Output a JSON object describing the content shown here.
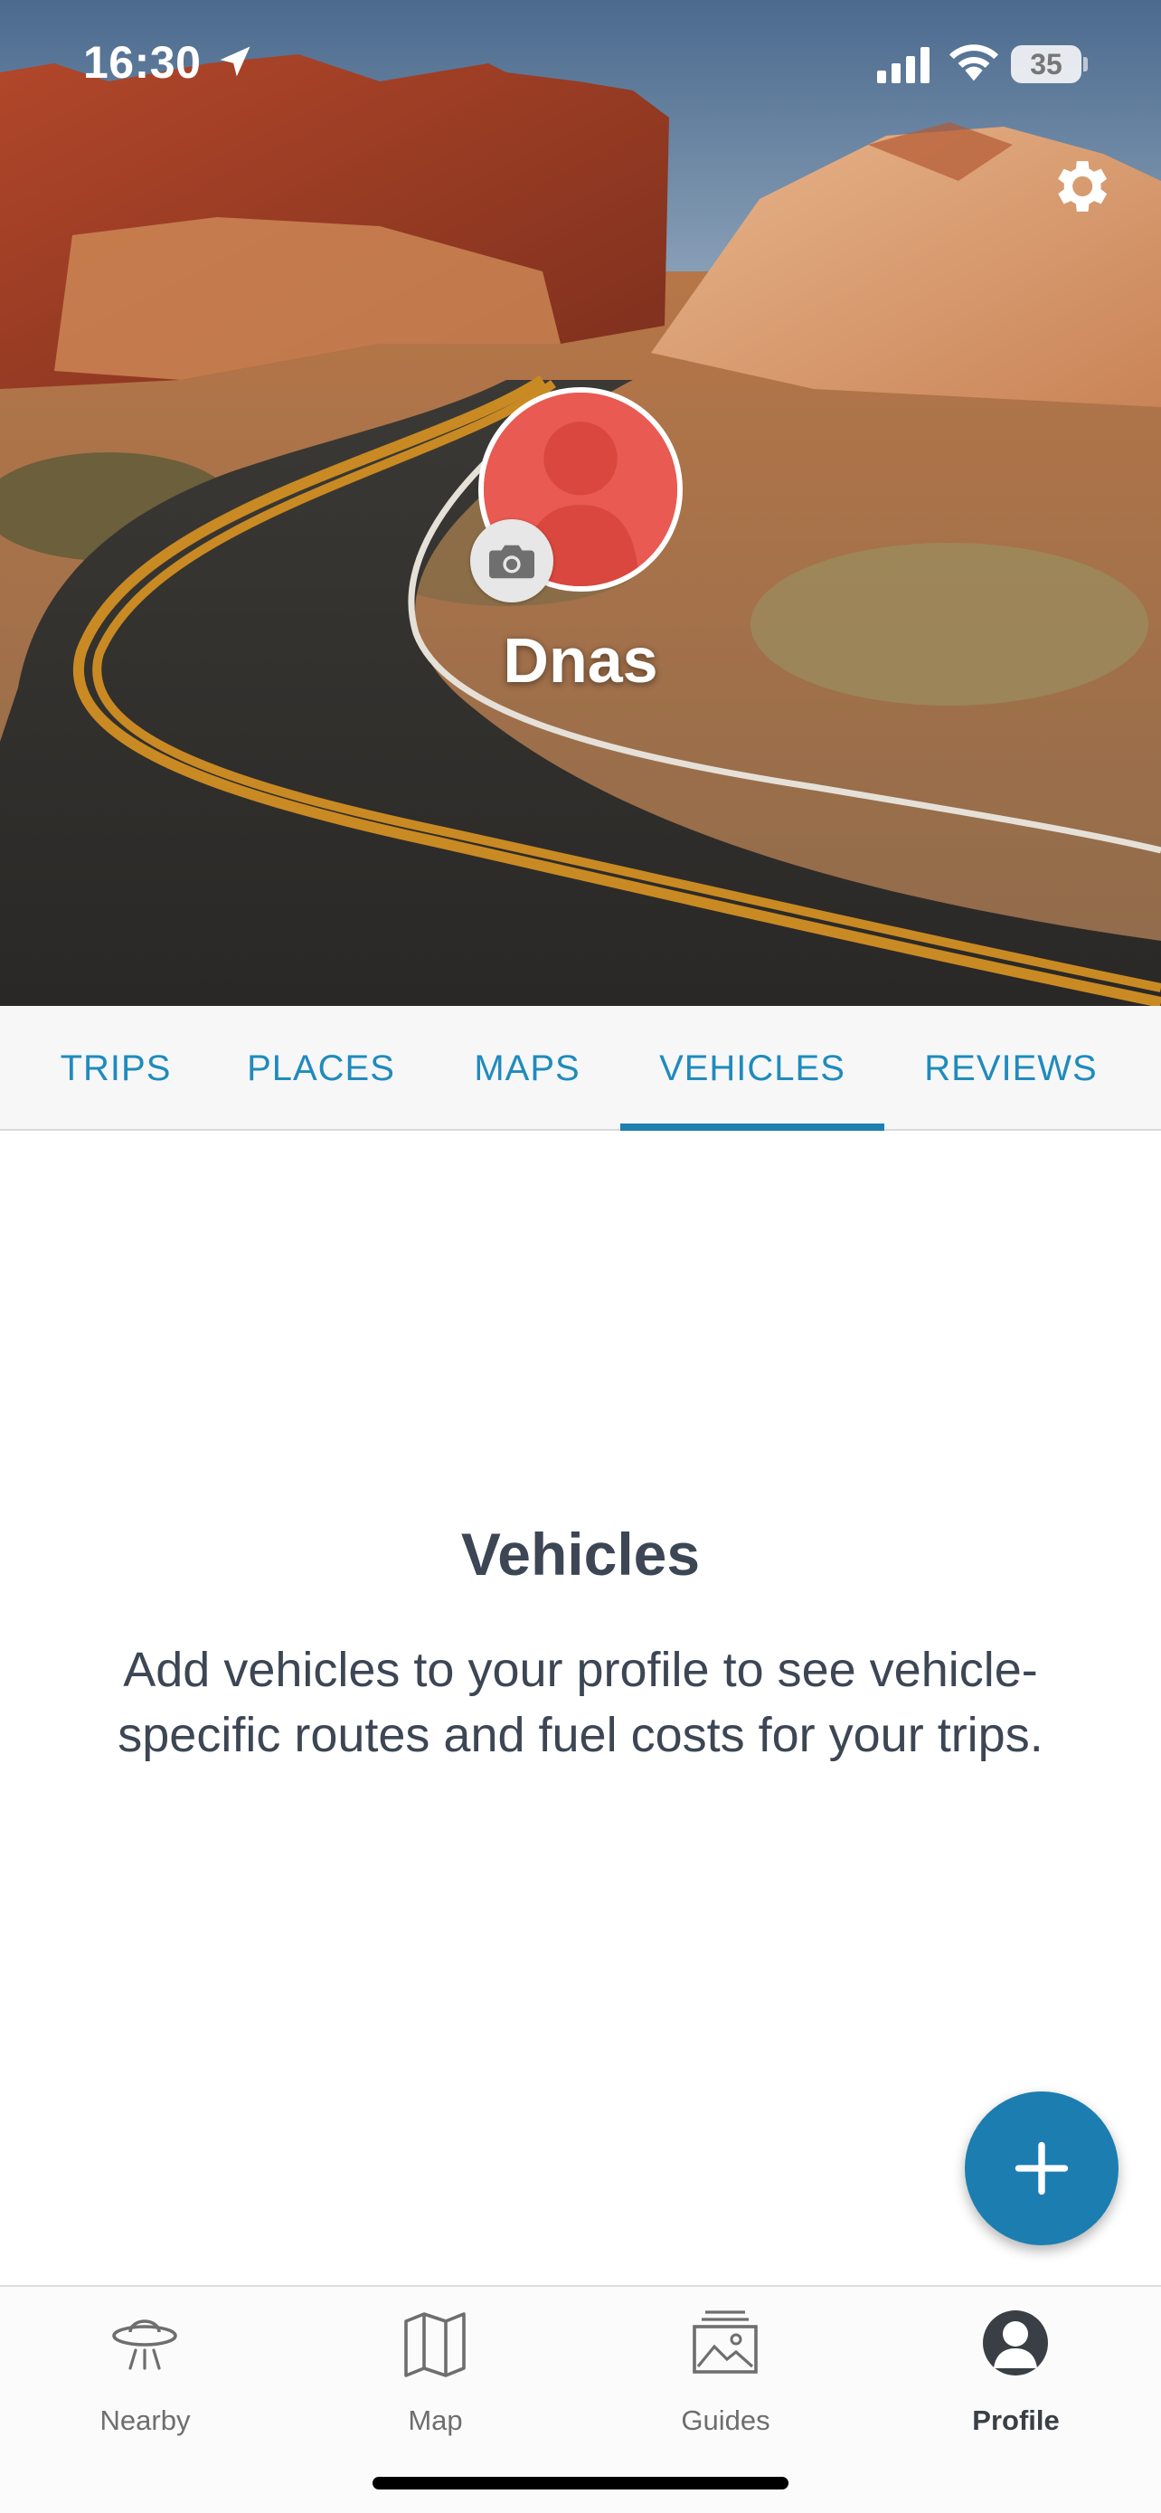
{
  "status_bar": {
    "time": "16:30",
    "battery": "35"
  },
  "profile": {
    "name": "Dnas",
    "avatar_color": "#e95a52"
  },
  "tabs": [
    {
      "label": "TRIPS",
      "active": false
    },
    {
      "label": "PLACES",
      "active": false
    },
    {
      "label": "MAPS",
      "active": false
    },
    {
      "label": "VEHICLES",
      "active": true
    },
    {
      "label": "REVIEWS",
      "active": false
    }
  ],
  "empty_state": {
    "title": "Vehicles",
    "text": "Add vehicles to your profile to see vehicle-specific routes and fuel costs for your trips."
  },
  "fab": {
    "icon": "plus-icon",
    "color": "#1c7eb0"
  },
  "bottom_nav": [
    {
      "label": "Nearby",
      "icon": "ufo-icon",
      "active": false
    },
    {
      "label": "Map",
      "icon": "map-icon",
      "active": false
    },
    {
      "label": "Guides",
      "icon": "guides-icon",
      "active": false
    },
    {
      "label": "Profile",
      "icon": "profile-icon",
      "active": true
    }
  ],
  "colors": {
    "accent": "#1f8bbd",
    "text_dark": "#3c4654"
  }
}
